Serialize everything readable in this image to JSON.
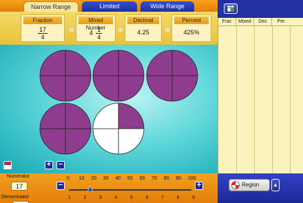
{
  "tabs": {
    "narrow": "Narrow Range",
    "limited": "Limited",
    "wide": "Wide Range"
  },
  "conversions": {
    "fraction_label": "Fraction",
    "fraction_num": "17",
    "fraction_den": "4",
    "mixed_label": "Mixed Number",
    "mixed_whole": "4",
    "mixed_num": "1",
    "mixed_den": "4",
    "decimal_label": "Decimal",
    "decimal_value": "4.25",
    "percent_label": "Percent",
    "percent_value": "425%",
    "equals": "="
  },
  "pies": {
    "count": 5,
    "parts_per_pie": 4,
    "filled_total": 17,
    "fill_color": "#8e3c8e",
    "empty_color": "#ffffff"
  },
  "buttons": {
    "plus": "+",
    "minus": "−"
  },
  "sliders": {
    "numerator_label": "Numerator",
    "numerator_value": "17",
    "numerator_ticks": [
      "0",
      "10",
      "20",
      "30",
      "40",
      "50",
      "60",
      "70",
      "80",
      "90",
      "100"
    ],
    "denominator_label": "Denominator",
    "denominator_ticks": [
      "1",
      "2",
      "3",
      "4",
      "5",
      "6",
      "7",
      "8",
      "9"
    ]
  },
  "table": {
    "columns": [
      "Frac",
      "Mixed",
      "Dec",
      "Per"
    ]
  },
  "region": {
    "label": "Region",
    "arrow": "▲"
  }
}
